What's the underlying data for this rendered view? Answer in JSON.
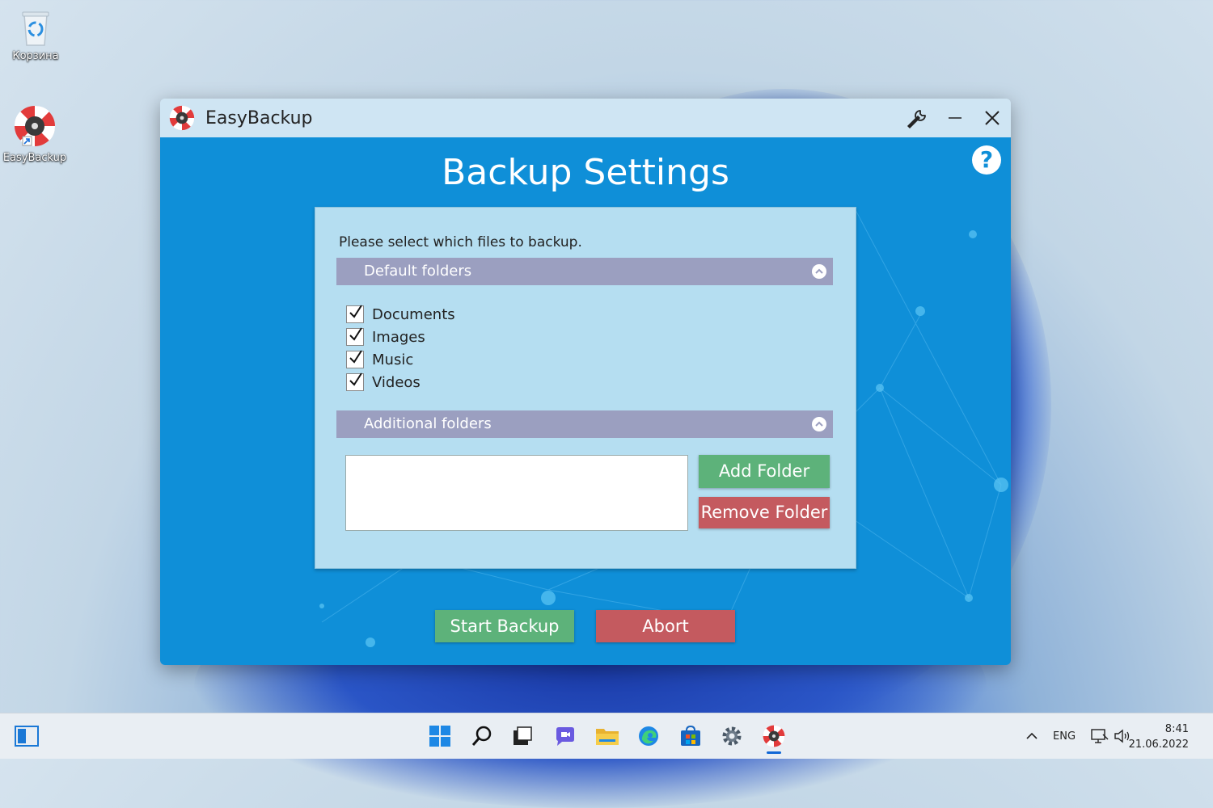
{
  "desktop": {
    "icons": [
      {
        "label": "Корзина",
        "icon": "recycle-bin-icon"
      },
      {
        "label": "EasyBackup",
        "icon": "easybackup-lifebuoy-icon"
      }
    ]
  },
  "window": {
    "title": "EasyBackup",
    "heading": "Backup Settings",
    "prompt": "Please select which files to backup.",
    "sections": {
      "default": {
        "label": "Default folders",
        "expanded": true
      },
      "additional": {
        "label": "Additional folders",
        "expanded": true
      }
    },
    "checkboxes": [
      {
        "label": "Documents",
        "checked": true
      },
      {
        "label": "Images",
        "checked": true
      },
      {
        "label": "Music",
        "checked": true
      },
      {
        "label": "Videos",
        "checked": true
      }
    ],
    "buttons": {
      "add_folder": "Add Folder",
      "remove_folder": "Remove Folder",
      "start_backup": "Start Backup",
      "abort": "Abort"
    },
    "colors": {
      "client_bg": "#0f8fd8",
      "panel_bg": "#b5def1",
      "section_bar": "#9b9fc0",
      "green_button": "#5db27a",
      "red_button": "#c45a5f"
    }
  },
  "taskbar": {
    "icons": [
      "widgets-icon",
      "start-icon",
      "search-icon",
      "task-view-icon",
      "chat-icon",
      "file-explorer-icon",
      "edge-icon",
      "store-icon",
      "settings-icon",
      "easybackup-icon"
    ],
    "language": "ENG",
    "time": "8:41",
    "date": "21.06.2022"
  }
}
